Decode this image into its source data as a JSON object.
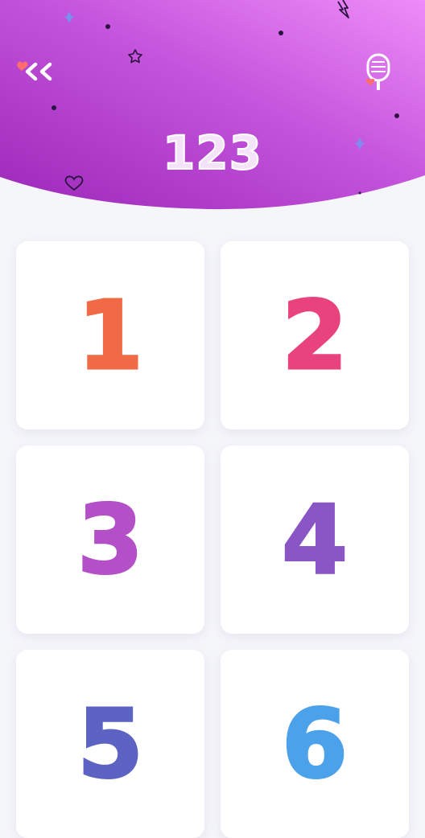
{
  "header": {
    "title": "123",
    "back_icon": "double-chevron-left-icon",
    "mic_icon": "microphone-icon",
    "gradient_start": "#a72fc1",
    "gradient_end": "#ea85f5"
  },
  "numbers": [
    {
      "label": "1",
      "color": "#f06a45"
    },
    {
      "label": "2",
      "color": "#e9437d"
    },
    {
      "label": "3",
      "color": "#b350c7"
    },
    {
      "label": "4",
      "color": "#8a55c5"
    },
    {
      "label": "5",
      "color": "#5d63c2"
    },
    {
      "label": "6",
      "color": "#4ba1ea"
    }
  ]
}
